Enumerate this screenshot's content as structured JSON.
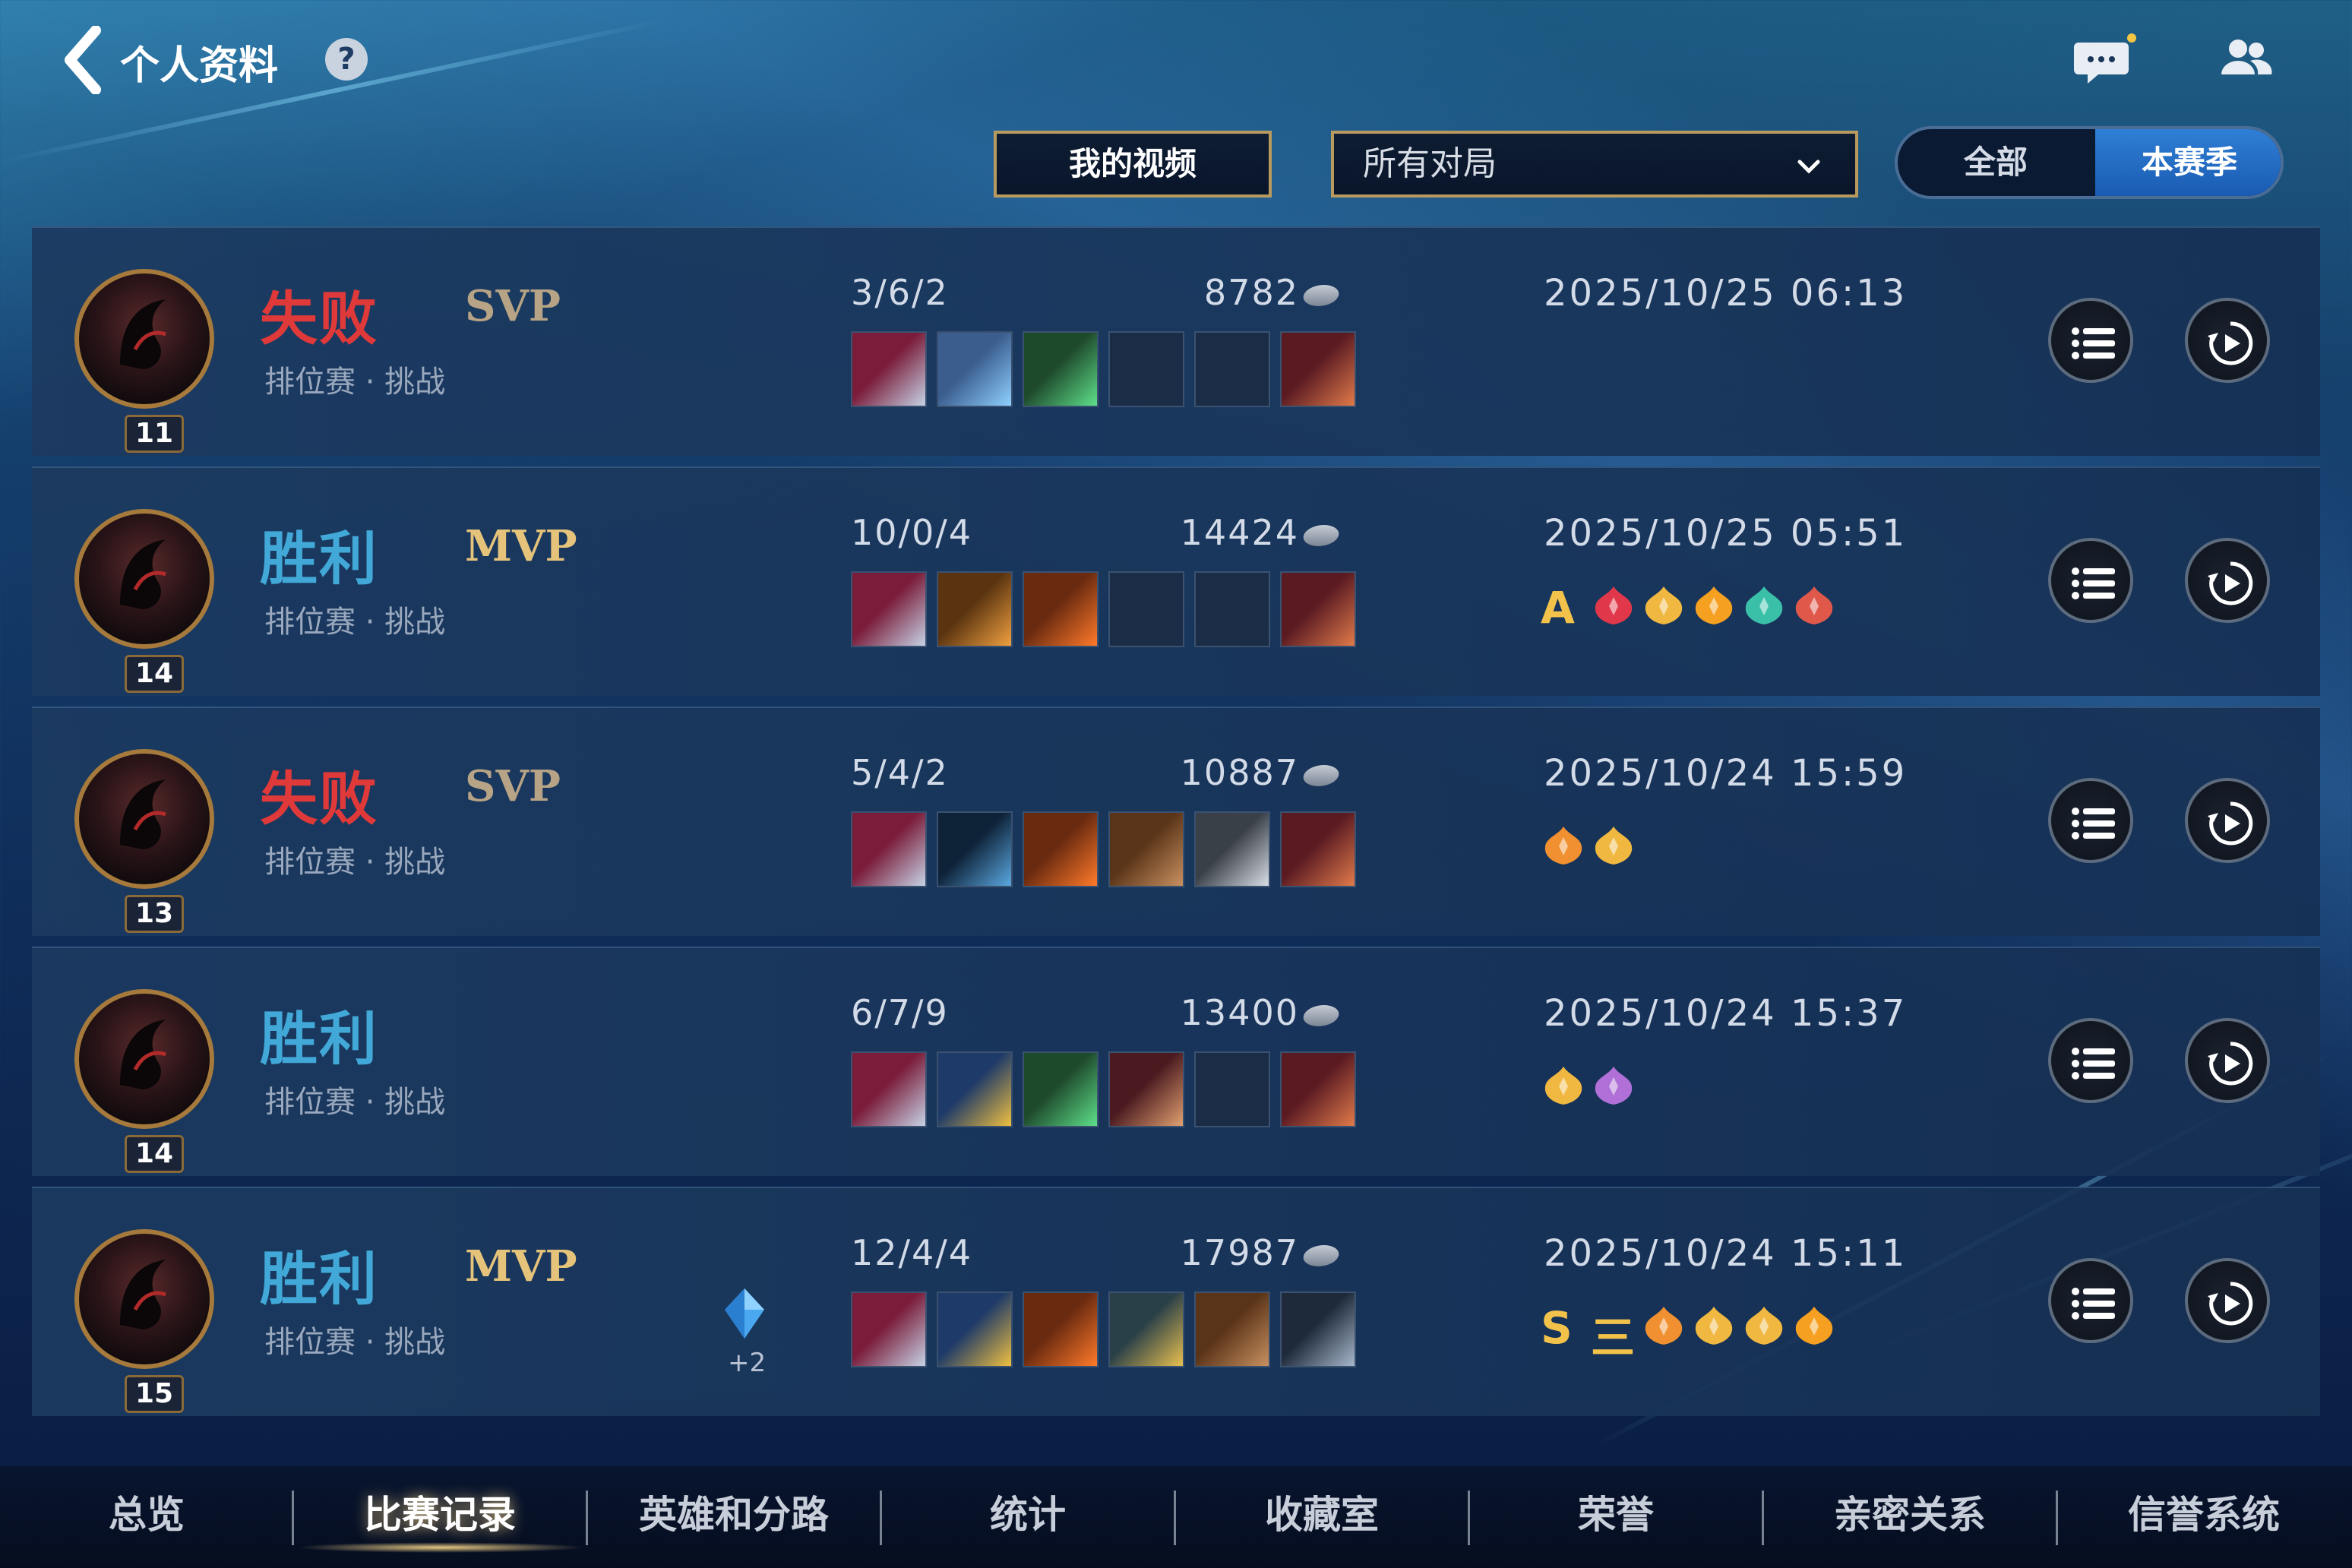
{
  "header": {
    "title": "个人资料",
    "help_symbol": "?",
    "icons": [
      "back-chevron-icon",
      "help-icon",
      "chat-icon",
      "friends-icon"
    ]
  },
  "controls": {
    "videos_button": "我的视频",
    "match_filter": {
      "selected": "所有对局"
    },
    "range_toggle": {
      "all": "全部",
      "season": "本赛季",
      "active": "本赛季"
    }
  },
  "matches": [
    {
      "level": "11",
      "result": "失败",
      "outcome": "lose",
      "badge": "SVP",
      "mode": "排位赛 · 挑战",
      "kda": "3/6/2",
      "gold": "8782",
      "datetime": "2025/10/25 06:13",
      "items": [
        "blade-scythe-icon",
        "armor-vest-icon",
        "green-helm-icon",
        "",
        "",
        "chain-hammer-icon"
      ],
      "medals": []
    },
    {
      "level": "14",
      "result": "胜利",
      "outcome": "win",
      "badge": "MVP",
      "mode": "排位赛 · 挑战",
      "kda": "10/0/4",
      "gold": "14424",
      "datetime": "2025/10/25 05:51",
      "items": [
        "blade-scythe-icon",
        "twin-arrows-icon",
        "flame-sword-icon",
        "",
        "",
        "chain-hammer-icon"
      ],
      "medals": [
        "A",
        "crown-medal-icon",
        "laurel-medal-icon",
        "flame-medal-icon",
        "shield-medal-icon",
        "demon-medal-icon"
      ]
    },
    {
      "level": "13",
      "result": "失败",
      "outcome": "lose",
      "badge": "SVP",
      "mode": "排位赛 · 挑战",
      "kda": "5/4/2",
      "gold": "10887",
      "datetime": "2025/10/24 15:59",
      "items": [
        "blade-scythe-icon",
        "dark-spear-icon",
        "flame-sword-icon",
        "hammer-icon",
        "broad-sword-icon",
        "chain-hammer-icon"
      ],
      "medals": [
        "winged-medal-icon",
        "laurel-medal-icon"
      ]
    },
    {
      "level": "14",
      "result": "胜利",
      "outcome": "win",
      "badge": "",
      "mode": "排位赛 · 挑战",
      "kda": "6/7/9",
      "gold": "13400",
      "datetime": "2025/10/24 15:37",
      "items": [
        "blade-scythe-icon",
        "gold-crossbow-icon",
        "green-helm-icon",
        "dagger-icon",
        "",
        "chain-hammer-icon"
      ],
      "medals": [
        "swirl-medal-icon",
        "purple-wing-medal-icon"
      ]
    },
    {
      "level": "15",
      "result": "胜利",
      "outcome": "win",
      "badge": "MVP",
      "mode": "排位赛 · 挑战",
      "kda": "12/4/4",
      "gold": "17987",
      "datetime": "2025/10/24 15:11",
      "items": [
        "blade-scythe-icon",
        "gold-crossbow-icon",
        "flame-sword-icon",
        "golden-dragon-icon",
        "hammer-icon",
        "spirit-mask-icon"
      ],
      "medals": [
        "S",
        "三",
        "winged-medal-icon",
        "laurel-medal-icon",
        "swirl-medal-icon",
        "flame-medal-icon"
      ],
      "bonus": "+2"
    }
  ],
  "bottom_nav": {
    "items": [
      "总览",
      "比赛记录",
      "英雄和分路",
      "统计",
      "收藏室",
      "荣誉",
      "亲密关系",
      "信誉系统"
    ],
    "active": "比赛记录"
  },
  "colors": {
    "lose": "#e0393a",
    "win": "#41a8d8",
    "mvp": "#e6c37a",
    "svp": "#b7a385",
    "accent_gold_border": "#b99a5e",
    "toggle_active": "#2f7fd6"
  }
}
